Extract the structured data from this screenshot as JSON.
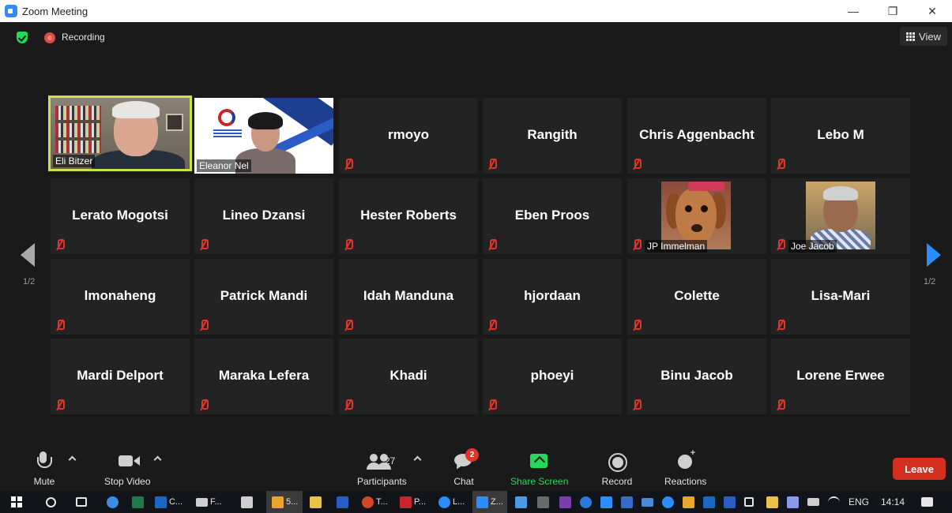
{
  "window": {
    "title": "Zoom Meeting",
    "controls": [
      "—",
      "❐",
      "✕"
    ]
  },
  "status": {
    "recording_label": "Recording",
    "view_label": "View"
  },
  "pager": {
    "left_text": "1/2",
    "right_text": "1/2"
  },
  "participants": [
    {
      "name": "Eli Bitzer",
      "video": "eli",
      "active": true
    },
    {
      "name": "Eleanor Nel",
      "video": "eleanor"
    },
    {
      "name": "rmoyo"
    },
    {
      "name": "Rangith"
    },
    {
      "name": "Chris Aggenbacht"
    },
    {
      "name": "Lebo M"
    },
    {
      "name": "Lerato Mogotsi"
    },
    {
      "name": "Lineo Dzansi"
    },
    {
      "name": "Hester Roberts"
    },
    {
      "name": "Eben Proos"
    },
    {
      "name": "JP Immelman",
      "avatar": "dog"
    },
    {
      "name": "Joe Jacob",
      "avatar": "joe"
    },
    {
      "name": "lmonaheng"
    },
    {
      "name": "Patrick Mandi"
    },
    {
      "name": "Idah Manduna"
    },
    {
      "name": "hjordaan"
    },
    {
      "name": "Colette"
    },
    {
      "name": "Lisa-Mari"
    },
    {
      "name": "Mardi Delport"
    },
    {
      "name": "Maraka Lefera"
    },
    {
      "name": "Khadi"
    },
    {
      "name": "phoeyi"
    },
    {
      "name": "Binu Jacob"
    },
    {
      "name": "Lorene Erwee"
    }
  ],
  "toolbar": {
    "mute_label": "Mute",
    "stop_video_label": "Stop Video",
    "participants_label": "Participants",
    "participants_count": "27",
    "chat_label": "Chat",
    "chat_badge": "2",
    "share_screen_label": "Share Screen",
    "record_label": "Record",
    "reactions_label": "Reactions",
    "leave_label": "Leave"
  },
  "taskbar": {
    "items": [
      "C...",
      "F...",
      "5...",
      "T...",
      "P...",
      "L...",
      "Z..."
    ],
    "lang": "ENG",
    "time": "14:14"
  },
  "colors": {
    "accent_blue": "#2d8cff",
    "recording_red": "#e34a3f",
    "secure_green": "#23d959",
    "active_speaker": "#c8e24a",
    "leave_red": "#d42e1e",
    "muted_red": "#e0352b"
  }
}
